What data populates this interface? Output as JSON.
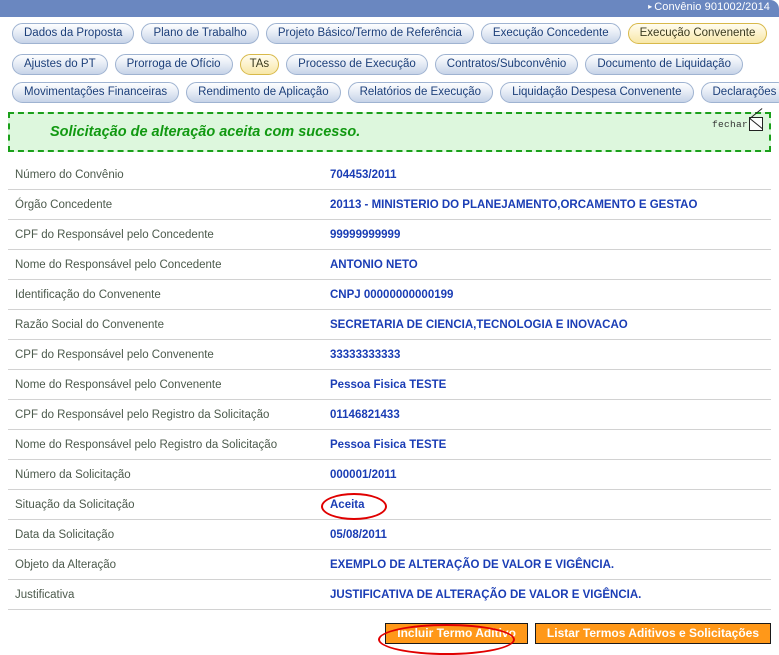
{
  "header": {
    "breadcrumb_arrow": "▸",
    "breadcrumb": "Convênio 901002/2014",
    "bar_color": "#6a87c0"
  },
  "tabs": {
    "primary": [
      {
        "label": "Dados da Proposta",
        "active": false
      },
      {
        "label": "Plano de Trabalho",
        "active": false
      },
      {
        "label": "Projeto Básico/Termo de Referência",
        "active": false
      },
      {
        "label": "Execução Concedente",
        "active": false
      },
      {
        "label": "Execução Convenente",
        "active": true
      }
    ],
    "secondary_row_1": [
      {
        "label": "Ajustes do PT",
        "active": false
      },
      {
        "label": "Prorroga de Ofício",
        "active": false
      },
      {
        "label": "TAs",
        "active": true
      },
      {
        "label": "Processo de Execução",
        "active": false
      },
      {
        "label": "Contratos/Subconvênio",
        "active": false
      },
      {
        "label": "Documento de Liquidação",
        "active": false
      }
    ],
    "secondary_row_2": [
      {
        "label": "Movimentações Financeiras",
        "active": false
      },
      {
        "label": "Rendimento de Aplicação",
        "active": false
      },
      {
        "label": "Relatórios de Execução",
        "active": false
      },
      {
        "label": "Liquidação Despesa Convenente",
        "active": false
      },
      {
        "label": "Declarações",
        "active": false
      }
    ]
  },
  "banner": {
    "message": "Solicitação de alteração aceita com sucesso.",
    "close_label": "fechar",
    "background_color": "#ddf7dd",
    "border_color": "#1aa01a",
    "text_color": "#119911"
  },
  "details": [
    {
      "label": "Número do Convênio",
      "value": "704453/2011"
    },
    {
      "label": "Órgão Concedente",
      "value": "20113 - MINISTERIO DO PLANEJAMENTO,ORCAMENTO E GESTAO"
    },
    {
      "label": "CPF do Responsável pelo Concedente",
      "value": "99999999999"
    },
    {
      "label": "Nome do Responsável pelo Concedente",
      "value": "ANTONIO NETO"
    },
    {
      "label": "Identificação do Convenente",
      "value": "CNPJ 00000000000199"
    },
    {
      "label": "Razão Social do Convenente",
      "value": "SECRETARIA DE CIENCIA,TECNOLOGIA E INOVACAO"
    },
    {
      "label": "CPF do Responsável pelo Convenente",
      "value": "33333333333"
    },
    {
      "label": "Nome do Responsável pelo Convenente",
      "value": "Pessoa Fisica TESTE"
    },
    {
      "label": "CPF do Responsável pelo Registro da Solicitação",
      "value": "01146821433"
    },
    {
      "label": "Nome do Responsável pelo Registro da Solicitação",
      "value": "Pessoa Fisica TESTE"
    },
    {
      "label": "Número da Solicitação",
      "value": "000001/2011"
    },
    {
      "label": "Situação da Solicitação",
      "value": "Aceita",
      "annotated": true
    },
    {
      "label": "Data da Solicitação",
      "value": "05/08/2011"
    },
    {
      "label": "Objeto da Alteração",
      "value": "EXEMPLO DE ALTERAÇÃO DE VALOR E VIGÊNCIA."
    },
    {
      "label": "Justificativa",
      "value": "JUSTIFICATIVA DE ALTERAÇÃO DE VALOR E VIGÊNCIA."
    }
  ],
  "actions": {
    "incluir_label": "Incluir Termo Aditivo",
    "listar_label": "Listar Termos Aditivos e Solicitações",
    "button_color": "#ff9819",
    "annotation_color": "#e00000"
  }
}
